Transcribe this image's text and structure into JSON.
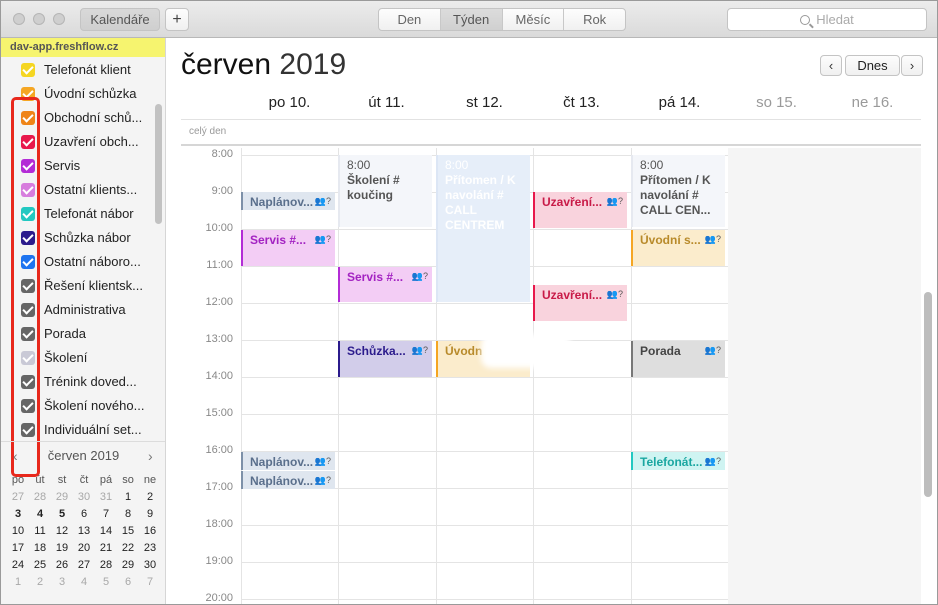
{
  "toolbar": {
    "calendars_label": "Kalendáře",
    "add_label": "+",
    "views": [
      "Den",
      "Týden",
      "Měsíc",
      "Rok"
    ],
    "active_view": "Týden",
    "search_placeholder": "Hledat"
  },
  "sidebar": {
    "account": "dav-app.freshflow.cz",
    "calendars": [
      {
        "label": "Telefonát klient",
        "color": "#f5d622"
      },
      {
        "label": "Úvodní schůzka",
        "color": "#f5a623"
      },
      {
        "label": "Obchodní schů...",
        "color": "#ef8417"
      },
      {
        "label": "Uzavření obch...",
        "color": "#e8184b"
      },
      {
        "label": "Servis",
        "color": "#b32cd6"
      },
      {
        "label": "Ostatní klients...",
        "color": "#d77ddd"
      },
      {
        "label": "Telefonát nábor",
        "color": "#22c8c1"
      },
      {
        "label": "Schůzka nábor",
        "color": "#2b1b8c"
      },
      {
        "label": "Ostatní nábоro...",
        "color": "#1e74f0"
      },
      {
        "label": "Řešení klientsk...",
        "color": "#666666"
      },
      {
        "label": "Administrativa",
        "color": "#666666"
      },
      {
        "label": "Porada",
        "color": "#666666"
      },
      {
        "label": "Školení",
        "color": "#c9c9d6"
      },
      {
        "label": "Trénink doved...",
        "color": "#666666"
      },
      {
        "label": "Školení nového...",
        "color": "#666666"
      },
      {
        "label": "Individuální set...",
        "color": "#666666"
      }
    ]
  },
  "mini_calendar": {
    "title": "červen 2019",
    "prev": "‹",
    "next": "›",
    "dow": [
      "po",
      "út",
      "st",
      "čt",
      "pá",
      "so",
      "ne"
    ],
    "weeks": [
      [
        "27",
        "28",
        "29",
        "30",
        "31",
        "1",
        "2"
      ],
      [
        "3",
        "4",
        "5",
        "6",
        "7",
        "8",
        "9"
      ],
      [
        "10",
        "11",
        "12",
        "13",
        "14",
        "15",
        "16"
      ],
      [
        "17",
        "18",
        "19",
        "20",
        "21",
        "22",
        "23"
      ],
      [
        "24",
        "25",
        "26",
        "27",
        "28",
        "29",
        "30"
      ],
      [
        "1",
        "2",
        "3",
        "4",
        "5",
        "6",
        "7"
      ]
    ]
  },
  "main": {
    "month": "červen",
    "year": "2019",
    "prev": "‹",
    "next": "›",
    "today_label": "Dnes",
    "allday_label": "celý den",
    "days": [
      "po 10.",
      "út 11.",
      "st 12.",
      "čt 13.",
      "pá 14.",
      "so 15.",
      "ne 16."
    ],
    "hours": [
      "8:00",
      "9:00",
      "10:00",
      "11:00",
      "12:00",
      "13:00",
      "14:00",
      "15:00",
      "16:00",
      "17:00",
      "18:00",
      "19:00",
      "20:00"
    ]
  },
  "events": {
    "e1": {
      "title": "Naplánov...",
      "icon": "👥?"
    },
    "e2": {
      "title": "Servis #...",
      "icon": "👥?"
    },
    "e3": {
      "title": "Naplánov...",
      "icon": "👥?"
    },
    "e4": {
      "title": "Naplánov...",
      "icon": "👥?"
    },
    "e5": {
      "time": "8:00",
      "title": "Školení # koučing"
    },
    "e6": {
      "title": "Servis #...",
      "icon": "👥?"
    },
    "e7": {
      "title": "Schůzka...",
      "icon": "👥?"
    },
    "e8": {
      "time": "8:00",
      "title": "Přítomen / K navolání # CALL CENTREM"
    },
    "e9": {
      "title": "Úvodn"
    },
    "e10": {
      "title": "Uzavření...",
      "icon": "👥?"
    },
    "e11": {
      "title": "Uzavření...",
      "icon": "👥?"
    },
    "e12": {
      "time": "8:00",
      "title": "Přítomen / K navolání # CALL CEN..."
    },
    "e13": {
      "title": "Úvodní s...",
      "icon": "👥?"
    },
    "e14": {
      "title": "Porada",
      "icon": "👥?"
    },
    "e15": {
      "title": "Telefonát...",
      "icon": "👥?"
    }
  }
}
